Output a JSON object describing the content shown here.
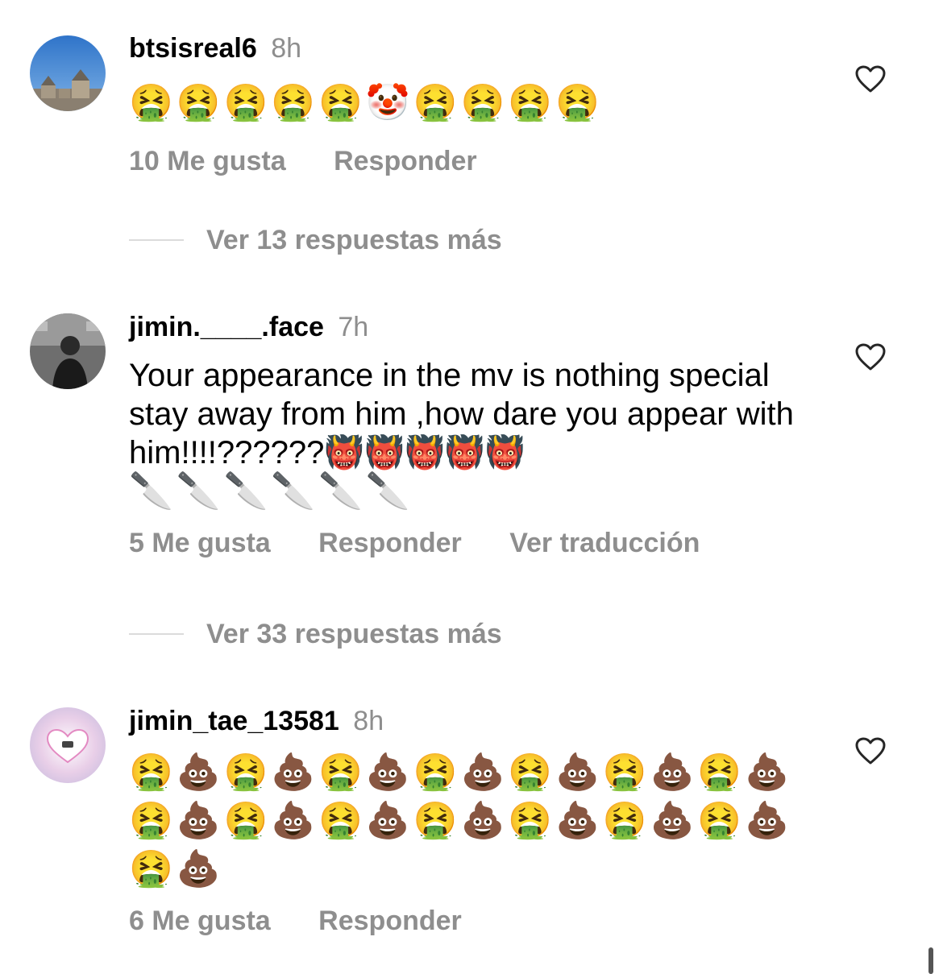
{
  "comments": [
    {
      "username": "btsisreal6",
      "time": "8h",
      "text": "",
      "emoji_lines": [
        "🤮🤮🤮🤮🤮🤡🤮🤮🤮🤮"
      ],
      "likes": "10 Me gusta",
      "reply": "Responder",
      "translate": "",
      "avatar_icon": "castle-photo-avatar",
      "more_replies": "Ver 13 respuestas más"
    },
    {
      "username": "jimin.____.face",
      "time": "7h",
      "text": "Your appearance in the mv is nothing special stay away from him ,how dare you appear with him!!!!??????👹👹👹👹👹",
      "emoji_lines": [
        "🔪🔪🔪🔪🔪🔪"
      ],
      "likes": "5 Me gusta",
      "reply": "Responder",
      "translate": "Ver traducción",
      "avatar_icon": "person-photo-avatar",
      "more_replies": "Ver 33 respuestas más"
    },
    {
      "username": "jimin_tae_13581",
      "time": "8h",
      "text": "",
      "emoji_lines": [
        "🤮💩🤮💩🤮💩🤮💩🤮💩🤮💩🤮💩",
        "🤮💩🤮💩🤮💩🤮💩🤮💩🤮💩🤮💩",
        "🤮💩"
      ],
      "likes": "6 Me gusta",
      "reply": "Responder",
      "translate": "",
      "avatar_icon": "heart-photo-avatar",
      "more_replies": ""
    }
  ],
  "colors": {
    "secondary_text": "#8e8e8e",
    "divider": "#dbdbdb"
  }
}
